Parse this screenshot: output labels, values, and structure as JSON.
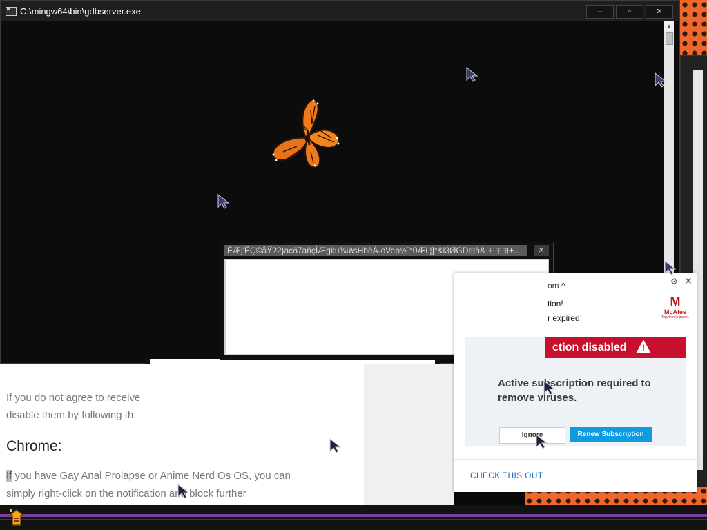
{
  "console": {
    "title": "C:\\mingw64\\bin\\gdbserver.exe",
    "minimize": "–",
    "maximize": "▫",
    "close": "✕"
  },
  "corrupt_dialog": {
    "title": "ÈÆj'ËÇ©åŸ?2}acð7añçÌÆgku¾ú\\sHbèÀ-oVeþ½´°0Æi  ¦]°&l3ØGD⊞à&·÷;⊞⊞±...",
    "close": "✕"
  },
  "article": {
    "p1_line1": "If you do not agree to receive",
    "p1_line2": "disable them by following th",
    "heading": "Chrome:",
    "p2_highlight": "If",
    "p2_rest": " you have Gay Anal Prolapse or Anime Nerd Os OS, you can simply right-click on the notification and block further"
  },
  "mcafee": {
    "header_line1": "om ^",
    "header_line2": "tion!",
    "header_line3": "r expired!",
    "gear": "⚙",
    "close": "✕",
    "logo_shield": "M",
    "logo_name": "McAfee",
    "logo_tagline": "Together is power.",
    "banner": "ction disabled",
    "message": "Active subscription required to remove viruses.",
    "ignore_label": "Ignore",
    "renew_label": "Renew Subscription",
    "footer_link": "CHECK THIS OUT"
  },
  "colors": {
    "mcafee_red": "#c8102e",
    "renew_blue": "#0f9be0",
    "taskbar_purple": "#7b3fa3"
  }
}
